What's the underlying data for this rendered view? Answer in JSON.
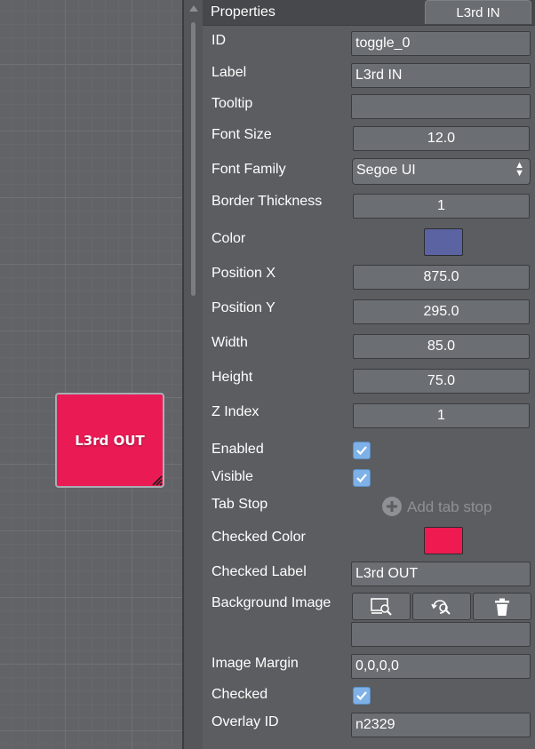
{
  "canvas": {
    "widget": {
      "label": "L3rd OUT",
      "color": "#ea1a55"
    }
  },
  "panel": {
    "title": "Properties",
    "tab_label": "L3rd IN",
    "properties": {
      "id": {
        "label": "ID",
        "value": "toggle_0"
      },
      "label": {
        "label": "Label",
        "value": "L3rd IN"
      },
      "tooltip": {
        "label": "Tooltip",
        "value": ""
      },
      "font_size": {
        "label": "Font Size",
        "value": "12.0"
      },
      "font_family": {
        "label": "Font Family",
        "value": "Segoe UI"
      },
      "border_thickness": {
        "label": "Border Thickness",
        "value": "1"
      },
      "color": {
        "label": "Color",
        "value": "#5b63a2"
      },
      "position_x": {
        "label": "Position X",
        "value": "875.0"
      },
      "position_y": {
        "label": "Position Y",
        "value": "295.0"
      },
      "width": {
        "label": "Width",
        "value": "85.0"
      },
      "height": {
        "label": "Height",
        "value": "75.0"
      },
      "z_index": {
        "label": "Z Index",
        "value": "1"
      },
      "enabled": {
        "label": "Enabled",
        "checked": true
      },
      "visible": {
        "label": "Visible",
        "checked": true
      },
      "tab_stop": {
        "label": "Tab Stop",
        "action_label": "Add tab stop"
      },
      "checked_color": {
        "label": "Checked Color",
        "value": "#ee1a50"
      },
      "checked_label": {
        "label": "Checked Label",
        "value": "L3rd OUT"
      },
      "background_image": {
        "label": "Background Image",
        "value": ""
      },
      "image_margin": {
        "label": "Image Margin",
        "value": "0,0,0,0"
      },
      "checked": {
        "label": "Checked",
        "checked": true
      },
      "overlay_id": {
        "label": "Overlay ID",
        "value": "n2329"
      }
    }
  }
}
